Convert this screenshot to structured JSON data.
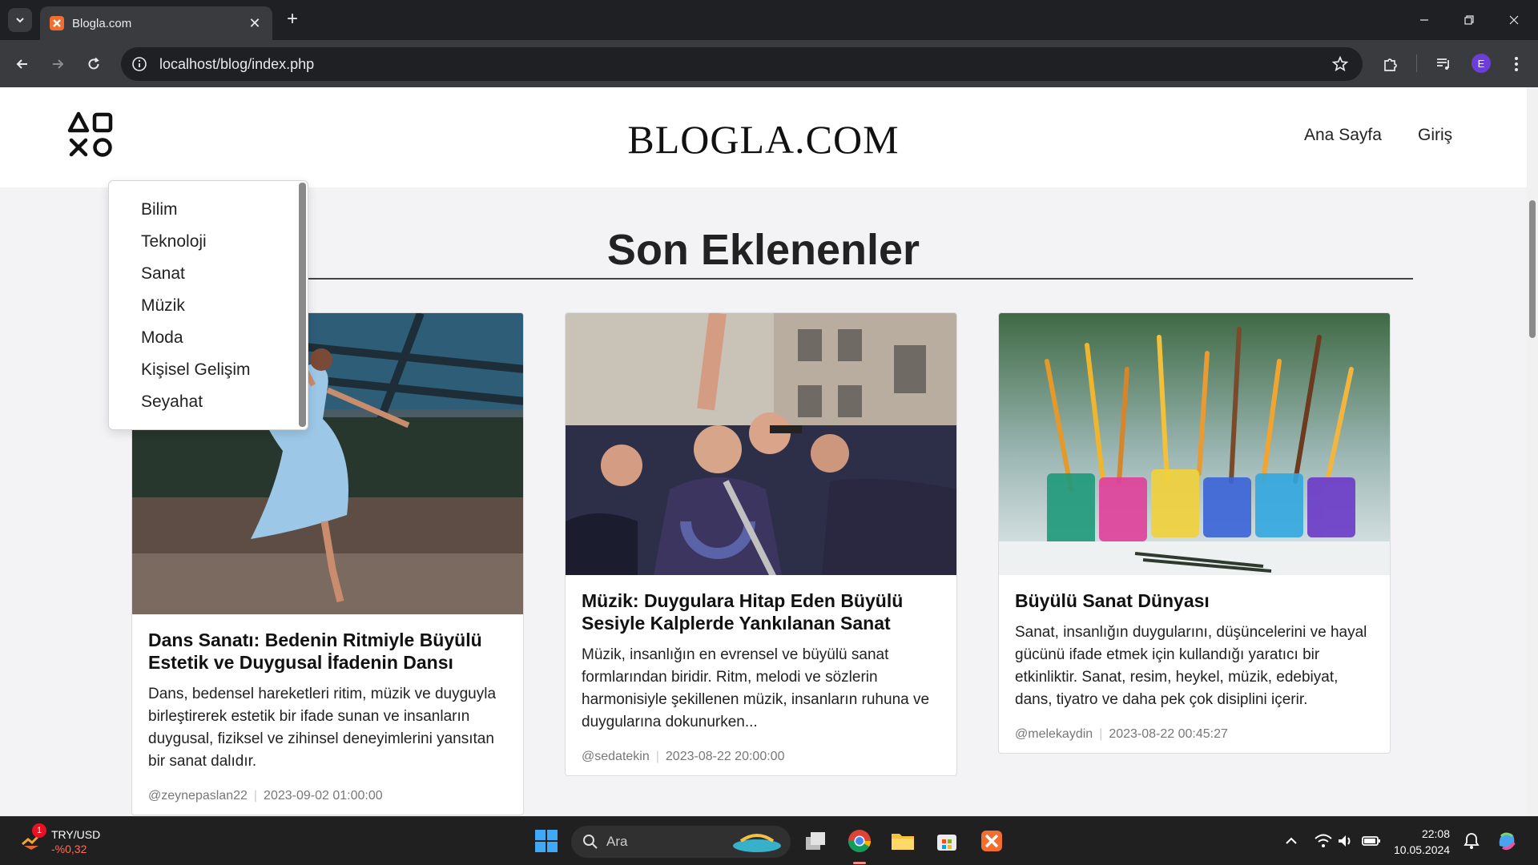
{
  "browser": {
    "tab_title": "Blogla.com",
    "url": "localhost/blog/index.php",
    "profile_initial": "E"
  },
  "site": {
    "brand": "BLOGLA.COM",
    "nav": [
      "Ana Sayfa",
      "Giriş"
    ],
    "section_title": "Son Eklenenler",
    "categories": [
      "Bilim",
      "Teknoloji",
      "Sanat",
      "Müzik",
      "Moda",
      "Kişisel Gelişim",
      "Seyahat"
    ]
  },
  "posts": [
    {
      "title": "Dans Sanatı: Bedenin Ritmiyle Büyülü Estetik ve Duygusal İfadenin Dansı",
      "excerpt": "Dans, bedensel hareketleri ritim, müzik ve duyguyla birleştirerek estetik bir ifade sunan ve insanların duygusal, fiziksel ve zihinsel deneyimlerini yansıtan bir sanat dalıdır.",
      "author": "@zeynepaslan22",
      "date": "2023-09-02 01:00:00"
    },
    {
      "title": "Müzik: Duygulara Hitap Eden Büyülü Sesiyle Kalplerde Yankılanan Sanat",
      "excerpt": "Müzik, insanlığın en evrensel ve büyülü sanat formlarından biridir. Ritm, melodi ve sözlerin harmonisiyle şekillenen müzik, insanların ruhuna ve duygularına dokunurken...",
      "author": "@sedatekin",
      "date": "2023-08-22 20:00:00"
    },
    {
      "title": "Büyülü Sanat Dünyası",
      "excerpt": "Sanat, insanlığın duygularını, düşüncelerini ve hayal gücünü ifade etmek için kullandığı yaratıcı bir etkinliktir. Sanat, resim, heykel, müzik, edebiyat, dans, tiyatro ve daha pek çok disiplini içerir.",
      "author": "@melekaydin",
      "date": "2023-08-22 00:45:27"
    }
  ],
  "taskbar": {
    "widget_badge": "1",
    "widget_title": "TRY/USD",
    "widget_value": "-%0,32",
    "search_placeholder": "Ara",
    "time": "22:08",
    "date": "10.05.2024"
  },
  "colors": {
    "chrome_dark": "#1f2023",
    "chrome_bar": "#3a3b3f",
    "page_bg": "#f3f3f5",
    "taskbar": "#202020",
    "xampp_orange": "#f26d2e"
  }
}
